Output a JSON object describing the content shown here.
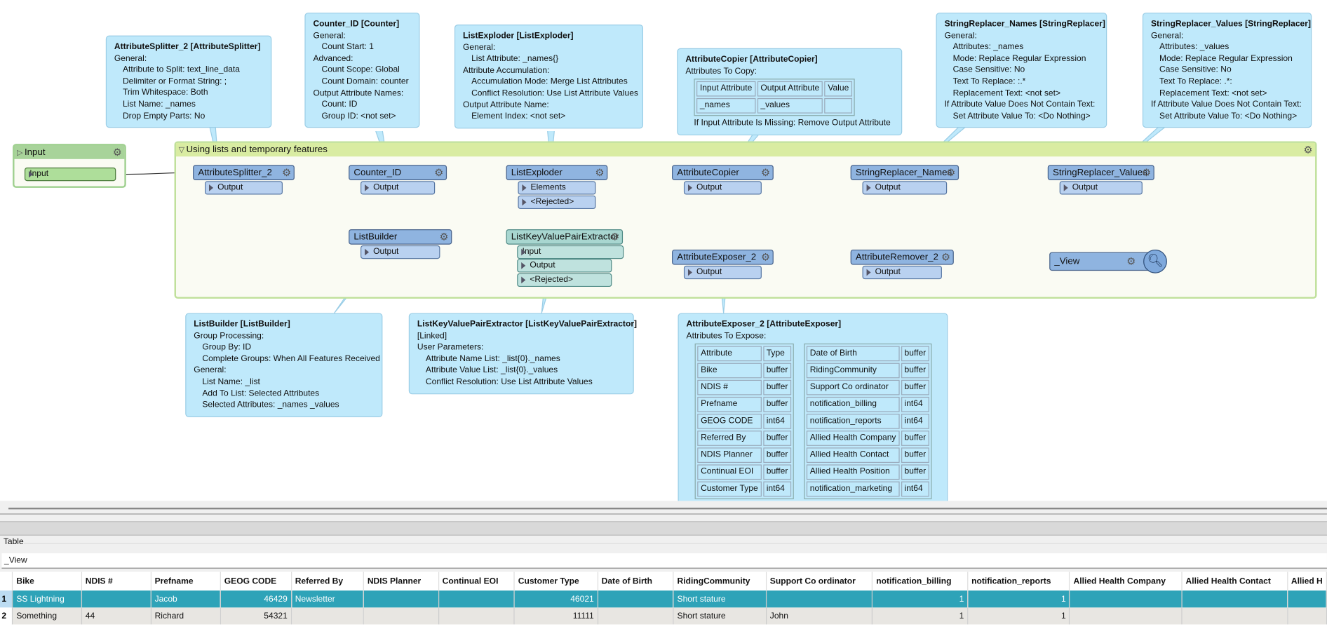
{
  "canvas": {
    "input_bookmark": {
      "title": "Input",
      "port": "Input"
    },
    "group_bookmark": {
      "title": "Using lists and temporary features"
    },
    "transformers": [
      {
        "id": "as",
        "name": "AttributeSplitter_2",
        "ports": [
          "Output"
        ]
      },
      {
        "id": "ctr",
        "name": "Counter_ID",
        "ports": [
          "Output"
        ]
      },
      {
        "id": "le",
        "name": "ListExploder",
        "ports": [
          "Elements",
          "<Rejected>"
        ]
      },
      {
        "id": "ac",
        "name": "AttributeCopier",
        "ports": [
          "Output"
        ]
      },
      {
        "id": "srn",
        "name": "StringReplacer_Names",
        "ports": [
          "Output"
        ]
      },
      {
        "id": "srv",
        "name": "StringReplacer_Values",
        "ports": [
          "Output"
        ]
      },
      {
        "id": "lb",
        "name": "ListBuilder",
        "ports": [
          "Output"
        ]
      },
      {
        "id": "lkv",
        "name": "ListKeyValuePairExtractor",
        "input": "Input",
        "ports": [
          "Output",
          "<Rejected>"
        ],
        "style": "teal"
      },
      {
        "id": "ae",
        "name": "AttributeExposer_2",
        "ports": [
          "Output"
        ]
      },
      {
        "id": "ar",
        "name": "AttributeRemover_2",
        "ports": [
          "Output"
        ]
      },
      {
        "id": "view",
        "name": "_View",
        "ports": [],
        "icon": "inspect-magnifier-icon"
      }
    ],
    "annotations": [
      {
        "id": "as",
        "lines": [
          [
            0,
            "AttributeSplitter_2 [AttributeSplitter]"
          ],
          [
            0,
            "General:"
          ],
          [
            1,
            "Attribute to Split: text_line_data"
          ],
          [
            1,
            "Delimiter or Format String: ;"
          ],
          [
            1,
            "Trim Whitespace: Both"
          ],
          [
            1,
            "List Name: _names"
          ],
          [
            1,
            "Drop Empty Parts: No"
          ]
        ]
      },
      {
        "id": "ctr",
        "lines": [
          [
            0,
            "Counter_ID [Counter]"
          ],
          [
            0,
            "General:"
          ],
          [
            1,
            "Count Start: 1"
          ],
          [
            0,
            "Advanced:"
          ],
          [
            1,
            "Count Scope: Global"
          ],
          [
            1,
            "Count Domain: counter"
          ],
          [
            0,
            "Output Attribute Names:"
          ],
          [
            1,
            "Count: ID"
          ],
          [
            1,
            "Group ID: <not set>"
          ]
        ]
      },
      {
        "id": "le",
        "lines": [
          [
            0,
            "ListExploder [ListExploder]"
          ],
          [
            0,
            "General:"
          ],
          [
            1,
            "List Attribute: _names{}"
          ],
          [
            0,
            "Attribute Accumulation:"
          ],
          [
            1,
            "Accumulation Mode: Merge List Attributes"
          ],
          [
            1,
            "Conflict Resolution: Use List Attribute Values"
          ],
          [
            0,
            "Output Attribute Name:"
          ],
          [
            1,
            "Element Index: <not set>"
          ]
        ]
      },
      {
        "id": "ac",
        "lines": [
          [
            0,
            "AttributeCopier [AttributeCopier]"
          ],
          [
            0,
            "Attributes To Copy:"
          ]
        ],
        "table": {
          "header": [
            "Input Attribute",
            "Output Attribute",
            "Value"
          ],
          "rows": [
            [
              "_names",
              "_values",
              ""
            ]
          ]
        },
        "after": [
          [
            1,
            "If Input Attribute Is Missing: Remove Output Attribute"
          ]
        ]
      },
      {
        "id": "srn",
        "lines": [
          [
            0,
            "StringReplacer_Names [StringReplacer]"
          ],
          [
            0,
            "General:"
          ],
          [
            1,
            "Attributes: _names"
          ],
          [
            1,
            "Mode: Replace Regular Expression"
          ],
          [
            1,
            "Case Sensitive: No"
          ],
          [
            1,
            "Text To Replace: :.*"
          ],
          [
            1,
            "Replacement Text: <not set>"
          ],
          [
            0,
            "If Attribute Value Does Not Contain Text:"
          ],
          [
            1,
            "Set Attribute Value To: <Do Nothing>"
          ]
        ]
      },
      {
        "id": "srv",
        "lines": [
          [
            0,
            "StringReplacer_Values [StringReplacer]"
          ],
          [
            0,
            "General:"
          ],
          [
            1,
            "Attributes: _values"
          ],
          [
            1,
            "Mode: Replace Regular Expression"
          ],
          [
            1,
            "Case Sensitive: No"
          ],
          [
            1,
            "Text To Replace: .*:"
          ],
          [
            1,
            "Replacement Text: <not set>"
          ],
          [
            0,
            "If Attribute Value Does Not Contain Text:"
          ],
          [
            1,
            "Set Attribute Value To: <Do Nothing>"
          ]
        ]
      },
      {
        "id": "lb",
        "lines": [
          [
            0,
            "ListBuilder [ListBuilder]"
          ],
          [
            0,
            "Group Processing:"
          ],
          [
            1,
            "Group By: ID"
          ],
          [
            1,
            "Complete Groups: When All Features Received"
          ],
          [
            0,
            "General:"
          ],
          [
            1,
            "List Name: _list"
          ],
          [
            1,
            "Add To List: Selected Attributes"
          ],
          [
            1,
            "Selected Attributes: _names _values"
          ]
        ]
      },
      {
        "id": "lkv",
        "lines": [
          [
            0,
            "ListKeyValuePairExtractor [ListKeyValuePairExtractor]"
          ],
          [
            0,
            "[Linked]"
          ],
          [
            0,
            "User Parameters:"
          ],
          [
            1,
            "Attribute Name List: _list{0}._names"
          ],
          [
            1,
            "Attribute Value List: _list{0}._values"
          ],
          [
            1,
            "Conflict Resolution: Use List Attribute Values"
          ]
        ]
      },
      {
        "id": "ae",
        "lines": [
          [
            0,
            "AttributeExposer_2 [AttributeExposer]"
          ],
          [
            0,
            "Attributes To Expose:"
          ]
        ],
        "table2": [
          {
            "header": [
              "Attribute",
              "Type"
            ],
            "rows": [
              [
                "Bike",
                "buffer"
              ],
              [
                "NDIS #",
                "buffer"
              ],
              [
                "Prefname",
                "buffer"
              ],
              [
                "GEOG CODE",
                "int64"
              ],
              [
                "Referred By",
                "buffer"
              ],
              [
                "NDIS Planner",
                "buffer"
              ],
              [
                "Continual EOI",
                "buffer"
              ],
              [
                "Customer Type",
                "int64"
              ]
            ]
          },
          {
            "header": [
              "Date of Birth",
              "buffer"
            ],
            "rows": [
              [
                "RidingCommunity",
                "buffer"
              ],
              [
                "Support Co ordinator",
                "buffer"
              ],
              [
                "notification_billing",
                "int64"
              ],
              [
                "notification_reports",
                "int64"
              ],
              [
                "Allied Health Company",
                "buffer"
              ],
              [
                "Allied Health Contact",
                "buffer"
              ],
              [
                "Allied Health Position",
                "buffer"
              ],
              [
                "notification_marketing",
                "int64"
              ]
            ]
          }
        ]
      }
    ]
  },
  "panel": {
    "section_label": "Table",
    "table_selector": "_View"
  },
  "table": {
    "columns": [
      "Bike",
      "NDIS #",
      "Prefname",
      "GEOG CODE",
      "Referred By",
      "NDIS Planner",
      "Continual EOI",
      "Customer Type",
      "Date of Birth",
      "RidingCommunity",
      "Support Co ordinator",
      "notification_billing",
      "notification_reports",
      "Allied Health Company",
      "Allied Health Contact",
      "Allied H"
    ],
    "rows": [
      {
        "num": "1",
        "selected": true,
        "cells": [
          "SS Lightning",
          "",
          "Jacob",
          "46429",
          "Newsletter",
          "",
          "",
          "46021",
          "",
          "Short stature",
          "",
          "1",
          "1",
          "",
          "",
          ""
        ]
      },
      {
        "num": "2",
        "selected": false,
        "cells": [
          "Something",
          "44",
          "Richard",
          "54321",
          "",
          "",
          "",
          "11111",
          "",
          "Short stature",
          "John",
          "1",
          "1",
          "",
          "",
          ""
        ]
      }
    ]
  },
  "colors": {
    "selected_row": "#2ea3b8",
    "annotation": "#bfe9fb",
    "transformer": "#8fb4e0",
    "bookmark_header": "#d9eca2"
  }
}
